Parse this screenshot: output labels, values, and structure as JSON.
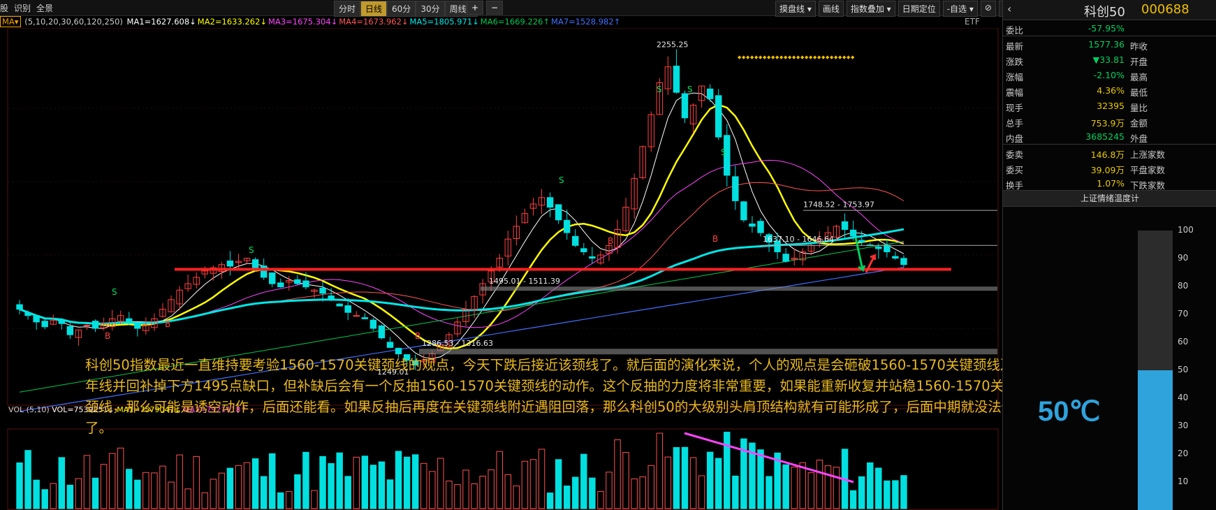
{
  "topbar": {
    "left_items": [
      "股",
      "识别",
      "全景"
    ],
    "periods": [
      {
        "label": "分时",
        "active": false
      },
      {
        "label": "日线",
        "active": true
      },
      {
        "label": "60分",
        "active": false
      },
      {
        "label": "30分",
        "active": false
      },
      {
        "label": "周线 ▾",
        "active": false
      }
    ],
    "zoom_in": "+",
    "zoom_out": "−",
    "right_items": [
      "摸盘线 ▾",
      "画线",
      "指数叠加 ▾",
      "日期定位",
      "-自选 ▾",
      "⊘",
      "✕"
    ]
  },
  "ma_legend": {
    "selector": "MA▾",
    "params": "(5,10,20,30,60,120,250)",
    "items": [
      {
        "text": "MA1=1627.608↓",
        "color": "#ffffff"
      },
      {
        "text": "MA2=1633.262↓",
        "color": "#ffff00"
      },
      {
        "text": "MA3=1675.304↓",
        "color": "#ff44ff"
      },
      {
        "text": "MA4=1673.962↓",
        "color": "#ff5555"
      },
      {
        "text": "MA5=1805.971↓",
        "color": "#00e6e6"
      },
      {
        "text": "MA6=1669.226↑",
        "color": "#00c850"
      },
      {
        "text": "MA7=1528.982↑",
        "color": "#3f6fff"
      }
    ],
    "etf": "ETF"
  },
  "chart_data": {
    "type": "candlestick",
    "instrument": "科创50 000688",
    "period": "日线",
    "price_labels": [
      {
        "text": "2255.25",
        "kind": "high"
      },
      {
        "text": "1748.52 - 1753.97",
        "kind": "range"
      },
      {
        "text": "1637.10 - 1646.64",
        "kind": "range"
      },
      {
        "text": "1495.01 - 1511.39",
        "kind": "range"
      },
      {
        "text": "1286.53 - 1316.63",
        "kind": "range"
      },
      {
        "text": "1249.01",
        "kind": "low"
      }
    ],
    "neckline": {
      "level_range": "1560-1570",
      "color": "#ff2020"
    },
    "signal_marks": [
      "S",
      "B"
    ],
    "close_series": [
      1440,
      1420,
      1400,
      1385,
      1405,
      1395,
      1360,
      1375,
      1390,
      1380,
      1395,
      1410,
      1420,
      1400,
      1380,
      1390,
      1410,
      1440,
      1470,
      1500,
      1520,
      1540,
      1560,
      1570,
      1580,
      1575,
      1590,
      1600,
      1570,
      1540,
      1520,
      1510,
      1530,
      1520,
      1510,
      1500,
      1490,
      1470,
      1450,
      1430,
      1420,
      1410,
      1380,
      1350,
      1320,
      1300,
      1280,
      1265,
      1280,
      1300,
      1330,
      1360,
      1400,
      1440,
      1480,
      1520,
      1560,
      1600,
      1660,
      1700,
      1740,
      1770,
      1790,
      1760,
      1720,
      1680,
      1640,
      1620,
      1600,
      1610,
      1640,
      1690,
      1760,
      1850,
      1950,
      2050,
      2150,
      2200,
      2120,
      2040,
      2080,
      2140,
      2100,
      1980,
      1860,
      1780,
      1720,
      1700,
      1680,
      1650,
      1620,
      1590,
      1600,
      1620,
      1640,
      1660,
      1680,
      1700,
      1690,
      1670,
      1650,
      1640,
      1630,
      1620,
      1600,
      1580
    ],
    "volume_legend": {
      "name": "VOL",
      "params": "(5,10)",
      "vol": "VOL=7539251↓",
      "ma1": "MA1=7579047↓",
      "ma2": "MA2=7921118↑"
    }
  },
  "annotation": "科创50指数最近一直维持要考验1560-1570关键颈线的观点，今天下跌后接近该颈线了。就后面的演化来说，个人的观点是会砸破1560-1570关键颈线及年线并回补掉下方1495点缺口，但补缺后会有一个反抽1560-1570关键颈线的动作。这个反抽的力度将非常重要，如果能重新收复并站稳1560-1570关键颈线，那么可能是诱空动作，后面还能看。如果反抽后再度在关键颈线附近遇阻回落，那么科创50的大级别头肩顶结构就有可能形成了，后面中期就没法做了。",
  "quote": {
    "name": "科创50",
    "code": "000688",
    "rows1": [
      {
        "label": "委比",
        "value": "-57.95%",
        "cls": "green"
      }
    ],
    "rows2": [
      {
        "label": "最新",
        "value": "1577.36",
        "cls": "green",
        "label2": "昨收"
      },
      {
        "label": "涨跌",
        "value": "▼33.81",
        "cls": "green",
        "label2": "开盘"
      },
      {
        "label": "涨幅",
        "value": "-2.10%",
        "cls": "green",
        "label2": "最高"
      },
      {
        "label": "震幅",
        "value": "4.36%",
        "cls": "yellow",
        "label2": "最低"
      },
      {
        "label": "现手",
        "value": "32395",
        "cls": "yellow",
        "label2": "量比"
      },
      {
        "label": "总手",
        "value": "753.9万",
        "cls": "yellow",
        "label2": "金额"
      },
      {
        "label": "内盘",
        "value": "3685245",
        "cls": "green",
        "label2": "外盘"
      }
    ],
    "rows3": [
      {
        "label": "委卖",
        "value": "146.8万",
        "cls": "yellow",
        "label2": "上涨家数"
      },
      {
        "label": "委买",
        "value": "39.09万",
        "cls": "yellow",
        "label2": "平盘家数"
      },
      {
        "label": "换手",
        "value": "1.07%",
        "cls": "yellow",
        "label2": "下跌家数"
      }
    ],
    "thermo_title": "上证情绪温度计",
    "thermo_value_text": "50℃",
    "thermo_value": 50,
    "thermo_ticks": [
      "100",
      "90",
      "80",
      "70",
      "60",
      "50",
      "40",
      "30",
      "20",
      "10"
    ]
  }
}
